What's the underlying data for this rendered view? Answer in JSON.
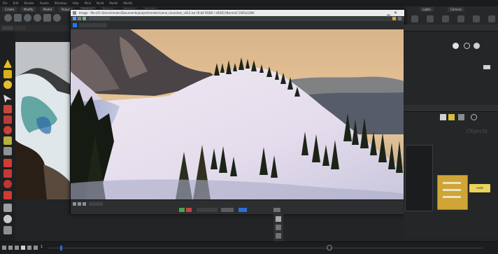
{
  "menubar": {
    "items": [
      "File",
      "Edit",
      "Render",
      "Assets",
      "Windows",
      "Help",
      "Main",
      "Build",
      "Model",
      "Modify"
    ]
  },
  "shelf": {
    "tabs": [
      "Create",
      "Modify",
      "Model",
      "Polygon",
      "Deform",
      "Texture",
      "Rigging",
      "Render"
    ],
    "right_tabs": [
      "Lights",
      "Camera"
    ]
  },
  "image_window": {
    "title": "Image - file:///C:/Users/render/Documents/project/render/scene_mountain_v012.exr  [8 bit RGBA / sRGB] [Normal] 1920x1080",
    "zoom": "28%"
  },
  "right_panel": {
    "ghost_label": "Objects",
    "node_label": "node"
  },
  "timeline": {
    "frame": "1"
  },
  "colors": {
    "accent_blue": "#2a6fd6",
    "node_yellow": "#d9b43a"
  }
}
